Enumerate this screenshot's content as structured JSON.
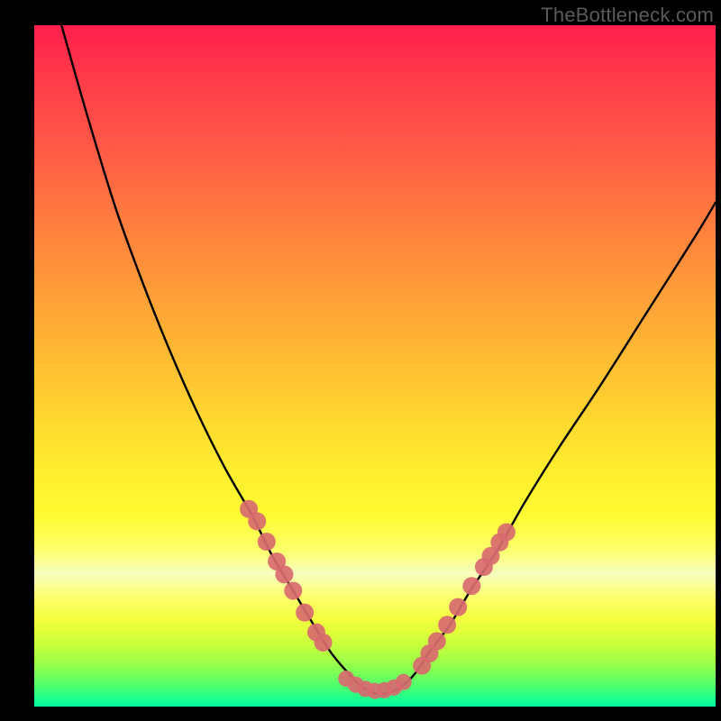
{
  "watermark": "TheBottleneck.com",
  "chart_data": {
    "type": "line",
    "title": "",
    "xlabel": "",
    "ylabel": "",
    "xlim": [
      0,
      100
    ],
    "ylim": [
      0,
      100
    ],
    "series": [
      {
        "name": "bottleneck-curve",
        "x": [
          4,
          8,
          12,
          16,
          20,
          24,
          28,
          32,
          35,
          38,
          41,
          43.5,
          46,
          48,
          50,
          52,
          54,
          56,
          58,
          61,
          64,
          68,
          72,
          77,
          83,
          90,
          97,
          100
        ],
        "y": [
          100,
          86,
          73,
          62,
          52,
          43,
          35,
          28,
          22,
          17,
          12,
          8,
          5,
          3,
          2,
          2,
          3,
          5,
          8,
          12,
          17,
          23,
          30,
          38,
          47,
          58,
          69,
          74
        ]
      }
    ],
    "markers": {
      "name": "highlight-dots",
      "color": "#d86a6f",
      "points_left": [
        {
          "x": 31.5,
          "y": 29.0
        },
        {
          "x": 32.7,
          "y": 27.2
        },
        {
          "x": 34.1,
          "y": 24.2
        },
        {
          "x": 35.6,
          "y": 21.3
        },
        {
          "x": 36.7,
          "y": 19.4
        },
        {
          "x": 38.0,
          "y": 17.0
        },
        {
          "x": 39.7,
          "y": 13.8
        },
        {
          "x": 41.4,
          "y": 10.9
        },
        {
          "x": 42.4,
          "y": 9.4
        }
      ],
      "points_right": [
        {
          "x": 56.9,
          "y": 6.0
        },
        {
          "x": 58.0,
          "y": 7.8
        },
        {
          "x": 59.1,
          "y": 9.6
        },
        {
          "x": 60.6,
          "y": 12.0
        },
        {
          "x": 62.2,
          "y": 14.6
        },
        {
          "x": 64.2,
          "y": 17.7
        },
        {
          "x": 66.0,
          "y": 20.5
        },
        {
          "x": 67.0,
          "y": 22.1
        },
        {
          "x": 68.3,
          "y": 24.1
        },
        {
          "x": 69.3,
          "y": 25.6
        }
      ],
      "points_bottom": [
        {
          "x": 45.8,
          "y": 4.1
        },
        {
          "x": 47.2,
          "y": 3.2
        },
        {
          "x": 48.6,
          "y": 2.6
        },
        {
          "x": 50.0,
          "y": 2.3
        },
        {
          "x": 51.4,
          "y": 2.4
        },
        {
          "x": 52.8,
          "y": 2.8
        },
        {
          "x": 54.2,
          "y": 3.6
        }
      ]
    },
    "gradient_colors": {
      "top": "#ff1f4c",
      "mid_upper": "#ff9a39",
      "mid": "#ffef2e",
      "band_light": "#f7ffbf",
      "mid_lower": "#a6ff46",
      "bottom": "#04f7a4"
    }
  }
}
